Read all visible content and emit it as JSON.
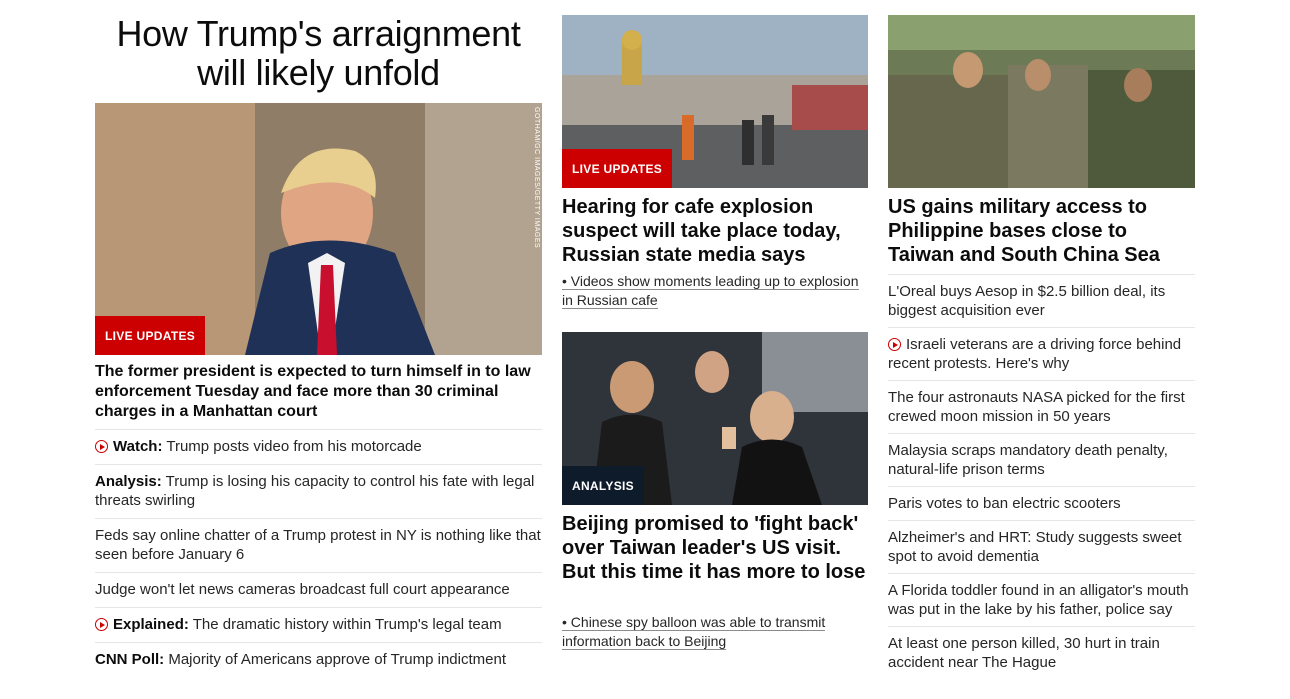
{
  "hero": {
    "title": "How Trump's arraignment will likely unfold",
    "badge": "LIVE UPDATES",
    "credit": "GOTHAM/GC IMAGES/GETTY IMAGES",
    "dek": "The former president is expected to turn himself in to law enforcement Tuesday and face more than 30 criminal charges in a Manhattan court"
  },
  "hero_list": [
    {
      "icon": "play-icon",
      "prefix": "Watch:",
      "text": "Trump posts video from his motorcade"
    },
    {
      "icon": "",
      "prefix": "Analysis:",
      "text": "Trump is losing his capacity to control his fate with legal threats swirling"
    },
    {
      "icon": "",
      "prefix": "",
      "text": "Feds say online chatter of a Trump protest in NY is nothing like that seen before January 6"
    },
    {
      "icon": "",
      "prefix": "",
      "text": "Judge won't let news cameras broadcast full court appearance"
    },
    {
      "icon": "play-icon",
      "prefix": "Explained:",
      "text": "The dramatic history within Trump's legal team"
    },
    {
      "icon": "",
      "prefix": "CNN Poll:",
      "text": "Majority of Americans approve of Trump indictment"
    }
  ],
  "story_a": {
    "badge": "LIVE UPDATES",
    "headline": "Hearing for cafe explosion suspect will take place today, Russian state media says",
    "sub": "• Videos show moments leading up to explosion in Russian cafe"
  },
  "story_b": {
    "badge": "ANALYSIS",
    "headline": "Beijing promised to 'fight back' over Taiwan leader's US visit. But this time it has more to lose",
    "sub": "• Chinese spy balloon was able to transmit information back to Beijing"
  },
  "story_c": {
    "headline": "US gains military access to Philippine bases close to Taiwan and South China Sea"
  },
  "col3_list": [
    {
      "icon": "",
      "text": "L'Oreal buys Aesop in $2.5 billion deal, its biggest acquisition ever"
    },
    {
      "icon": "play-icon",
      "text": "Israeli veterans are a driving force behind recent protests. Here's why"
    },
    {
      "icon": "",
      "text": "The four astronauts NASA picked for the first crewed moon mission in 50 years"
    },
    {
      "icon": "",
      "text": "Malaysia scraps mandatory death penalty, natural-life prison terms"
    },
    {
      "icon": "",
      "text": "Paris votes to ban electric scooters"
    },
    {
      "icon": "",
      "text": "Alzheimer's and HRT: Study suggests sweet spot to avoid dementia"
    },
    {
      "icon": "",
      "text": "A Florida toddler found in an alligator's mouth was put in the lake by his father, police say"
    },
    {
      "icon": "",
      "text": "At least one person killed, 30 hurt in train accident near The Hague"
    }
  ],
  "colors": {
    "accent": "#cc0000",
    "analysis_badge": "#0e1b2b"
  }
}
